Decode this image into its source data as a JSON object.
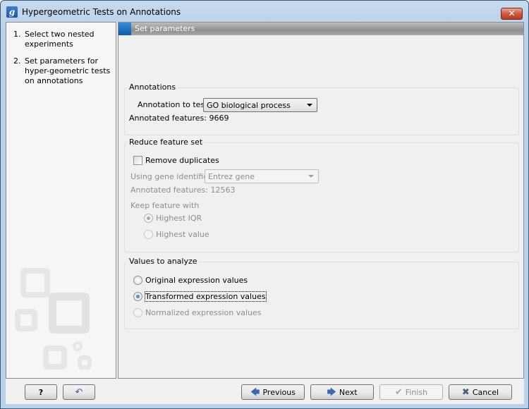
{
  "window": {
    "title": "Hypergeometric Tests on Annotations",
    "app_icon_glyph": "g",
    "close_glyph": "✕"
  },
  "steps": [
    {
      "num": "1.",
      "label": "Select two nested experiments"
    },
    {
      "num": "2.",
      "label": "Set parameters for hyper-geometric tests on annotations"
    }
  ],
  "panel": {
    "title": "Set parameters"
  },
  "annotations": {
    "legend": "Annotations",
    "annotation_label": "Annotation to test",
    "annotation_value": "GO biological process",
    "annotated_label": "Annotated features:",
    "annotated_value": "9669"
  },
  "reduce": {
    "legend": "Reduce feature set",
    "remove_duplicates_label": "Remove duplicates",
    "remove_duplicates_checked": false,
    "gene_identifier_label": "Using gene identifier",
    "gene_identifier_value": "Entrez gene",
    "annotated_label": "Annotated features:",
    "annotated_value": "12563",
    "keep_label": "Keep feature with",
    "keep_options": [
      {
        "label": "Highest IQR",
        "selected": true,
        "enabled": false
      },
      {
        "label": "Highest value",
        "selected": false,
        "enabled": false
      }
    ]
  },
  "values": {
    "legend": "Values to analyze",
    "options": [
      {
        "label": "Original expression values",
        "selected": false,
        "enabled": true
      },
      {
        "label": "Transformed expression values",
        "selected": true,
        "enabled": true
      },
      {
        "label": "Normalized expression values",
        "selected": false,
        "enabled": false
      }
    ]
  },
  "buttons": {
    "help": "?",
    "reset_icon": "↶",
    "previous": "Previous",
    "previous_icon": "🡄",
    "next": "Next",
    "next_icon": "🡆",
    "finish": "Finish",
    "finish_icon": "✔",
    "cancel": "Cancel",
    "cancel_icon": "✖"
  }
}
